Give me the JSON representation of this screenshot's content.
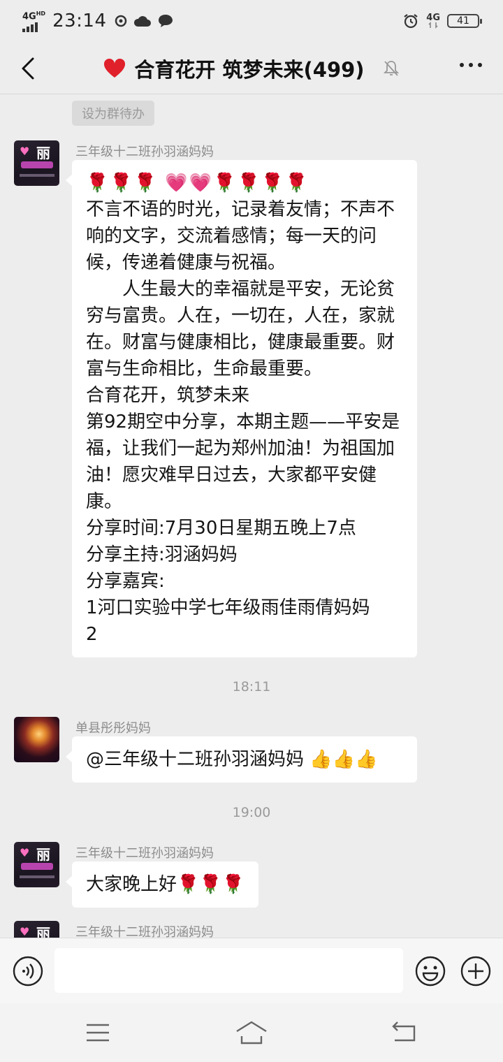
{
  "status_bar": {
    "network": "4G",
    "network_sup": "HD",
    "time": "23:14",
    "network_right": "4G",
    "battery": "41"
  },
  "header": {
    "title": "合育花开 筑梦未来(499)"
  },
  "chat": {
    "todo_chip": "设为群待办",
    "messages": [
      {
        "sender": "三年级十二班孙羽涵妈妈",
        "emoji_line": [
          "🌹",
          "🌹",
          "🌹",
          "💗",
          "💗",
          "🌹",
          "🌹",
          "🌹",
          "🌹"
        ],
        "text": "不言不语的时光，记录着友情；不声不响的文字，交流着感情；每一天的问候，传递着健康与祝福。\n　　人生最大的幸福就是平安，无论贫穷与富贵。人在，一切在，人在，家就在。财富与健康相比，健康最重要。财富与生命相比，生命最重要。\n合育花开，筑梦未来\n第92期空中分享，本期主题——平安是福，让我们一起为郑州加油！为祖国加油！愿灾难早日过去，大家都平安健康。\n分享时间:7月30日星期五晚上7点\n分享主持:羽涵妈妈\n分享嘉宾:\n1河口实验中学七年级雨佳雨倩妈妈\n2"
      },
      {
        "timestamp": "18:11"
      },
      {
        "sender": "单县彤彤妈妈",
        "text": "@三年级十二班孙羽涵妈妈 ",
        "emoji_tail": [
          "👍",
          "👍",
          "👍"
        ]
      },
      {
        "timestamp": "19:00"
      },
      {
        "sender": "三年级十二班孙羽涵妈妈",
        "text": "大家晚上好",
        "emoji_tail": [
          "🌹",
          "🌹",
          "🌹"
        ]
      },
      {
        "sender": "三年级十二班孙羽涵妈妈"
      }
    ]
  },
  "avatar_li_text": "丽",
  "input": {
    "placeholder": ""
  },
  "colors": {
    "background": "#ededed",
    "bubble": "#ffffff",
    "title_heart": "#e0202a",
    "rose": "#d8232a"
  }
}
